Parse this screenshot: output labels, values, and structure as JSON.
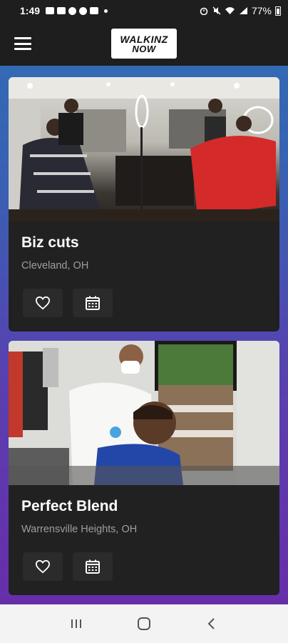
{
  "status_bar": {
    "time": "1:49",
    "battery": "77%"
  },
  "app_bar": {
    "logo_line1": "WALKINZ",
    "logo_line2": "NOW"
  },
  "shops": [
    {
      "name": "Biz cuts",
      "location": "Cleveland, OH"
    },
    {
      "name": "Perfect Blend",
      "location": "Warrensville Heights, OH"
    }
  ],
  "icons": {
    "menu": "hamburger-menu-icon",
    "favorite": "heart-outline-icon",
    "calendar": "calendar-icon",
    "recents": "recent-apps-icon",
    "home": "home-icon",
    "back": "back-icon"
  },
  "colors": {
    "app_bar": "#1e1e1e",
    "card": "#212121",
    "button": "#2b2b2b",
    "location_text": "#9e9e9e"
  }
}
